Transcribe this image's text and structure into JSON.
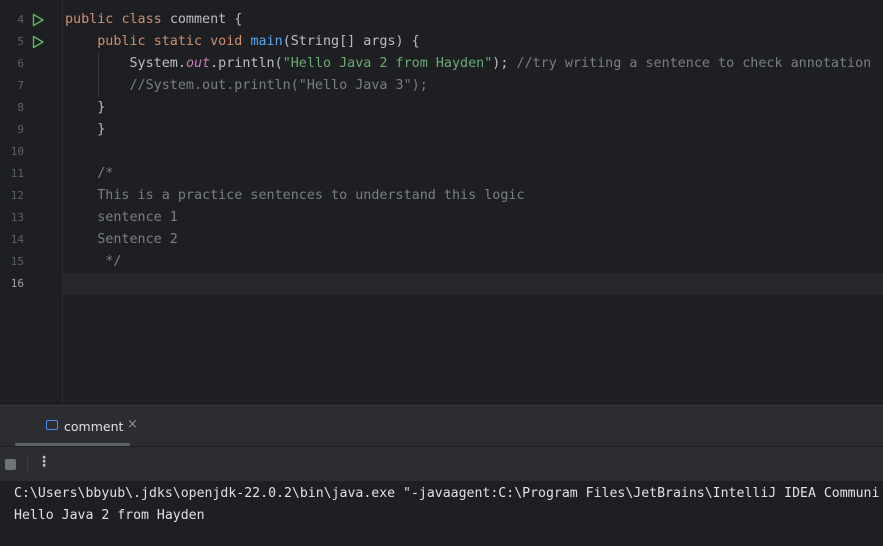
{
  "editor": {
    "lines": [
      {
        "n": "4",
        "run": true,
        "tokens": [
          {
            "t": "public ",
            "c": "kw"
          },
          {
            "t": "class ",
            "c": "kw"
          },
          {
            "t": "comment {",
            "c": ""
          }
        ]
      },
      {
        "n": "5",
        "run": true,
        "tokens": [
          {
            "t": "    ",
            "c": ""
          },
          {
            "t": "public ",
            "c": "kw"
          },
          {
            "t": "static ",
            "c": "kw"
          },
          {
            "t": "void ",
            "c": "kw"
          },
          {
            "t": "main",
            "c": "fn"
          },
          {
            "t": "(String[] args) {",
            "c": ""
          }
        ]
      },
      {
        "n": "6",
        "run": false,
        "tokens": [
          {
            "t": "        System.",
            "c": ""
          },
          {
            "t": "out",
            "c": "st"
          },
          {
            "t": ".println(",
            "c": ""
          },
          {
            "t": "\"Hello Java 2 from Hayden\"",
            "c": "str"
          },
          {
            "t": "); ",
            "c": ""
          },
          {
            "t": "//try writing a sentence to check annotation",
            "c": "cm"
          }
        ]
      },
      {
        "n": "7",
        "run": false,
        "tokens": [
          {
            "t": "        ",
            "c": ""
          },
          {
            "t": "//System.out.println(\"Hello Java 3\");",
            "c": "cm"
          }
        ]
      },
      {
        "n": "8",
        "run": false,
        "tokens": [
          {
            "t": "    }",
            "c": ""
          }
        ]
      },
      {
        "n": "9",
        "run": false,
        "tokens": [
          {
            "t": "    }",
            "c": ""
          }
        ]
      },
      {
        "n": "10",
        "run": false,
        "tokens": []
      },
      {
        "n": "11",
        "run": false,
        "tokens": [
          {
            "t": "    /*",
            "c": "cm"
          }
        ]
      },
      {
        "n": "12",
        "run": false,
        "tokens": [
          {
            "t": "    This is a practice sentences to understand this logic",
            "c": "cm"
          }
        ]
      },
      {
        "n": "13",
        "run": false,
        "tokens": [
          {
            "t": "    sentence 1",
            "c": "cm"
          }
        ]
      },
      {
        "n": "14",
        "run": false,
        "tokens": [
          {
            "t": "    Sentence 2",
            "c": "cm"
          }
        ]
      },
      {
        "n": "15",
        "run": false,
        "tokens": [
          {
            "t": "     */",
            "c": "cm"
          }
        ]
      },
      {
        "n": "16",
        "run": false,
        "current": true,
        "tokens": []
      }
    ]
  },
  "run_panel": {
    "tab_label": "comment",
    "close_glyph": "×",
    "more_glyph": "⋮",
    "output": [
      "C:\\Users\\bbyub\\.jdks\\openjdk-22.0.2\\bin\\java.exe \"-javaagent:C:\\Program Files\\JetBrains\\IntelliJ IDEA Communi",
      "Hello Java 2 from Hayden"
    ]
  },
  "colors": {
    "keyword": "#cf8e6d",
    "function": "#56a8f5",
    "string": "#6aab73",
    "comment": "#7a7e85",
    "static_field": "#c77dbb",
    "run_icon": "#5fb865"
  },
  "icons": {
    "run": "run-gutter-icon",
    "stop": "stop-icon",
    "console_tab": "console-tab-icon",
    "close": "close-icon",
    "more": "more-vertical-icon"
  }
}
